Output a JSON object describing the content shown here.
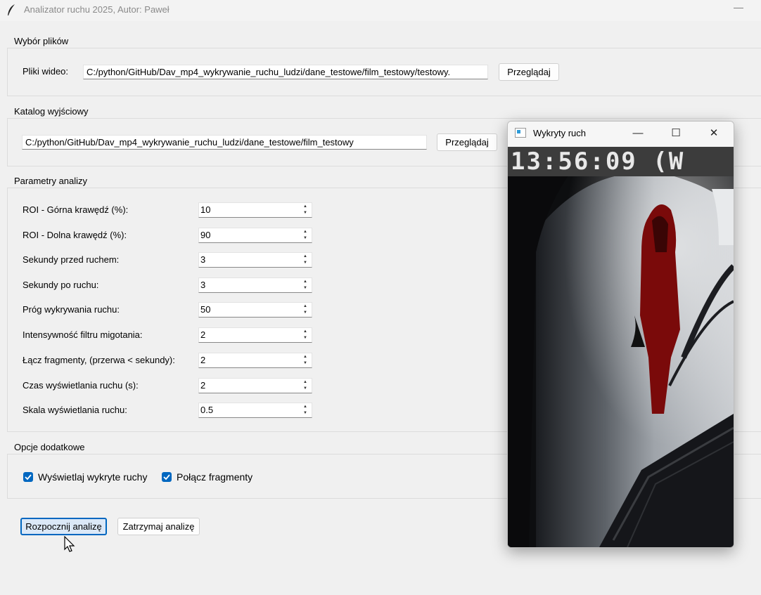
{
  "window": {
    "title": "Analizator ruchu 2025, Autor: Paweł",
    "minimize_glyph": "—"
  },
  "files": {
    "legend": "Wybór plików",
    "video_label": "Pliki wideo:",
    "video_path": "C:/python/GitHub/Dav_mp4_wykrywanie_ruchu_ludzi/dane_testowe/film_testowy/testowy.",
    "browse_label": "Przeglądaj"
  },
  "output": {
    "legend": "Katalog wyjściowy",
    "path": "C:/python/GitHub/Dav_mp4_wykrywanie_ruchu_ludzi/dane_testowe/film_testowy",
    "browse_label": "Przeglądaj"
  },
  "params": {
    "legend": "Parametry analizy",
    "rows": [
      {
        "label": "ROI - Górna krawędź (%):",
        "value": "10"
      },
      {
        "label": "ROI - Dolna krawędź (%):",
        "value": "90"
      },
      {
        "label": "Sekundy przed ruchem:",
        "value": "3"
      },
      {
        "label": "Sekundy po ruchu:",
        "value": "3"
      },
      {
        "label": "Próg wykrywania ruchu:",
        "value": "50"
      },
      {
        "label": "Intensywność filtru migotania:",
        "value": "2"
      },
      {
        "label": "Łącz fragmenty, (przerwa < sekundy):",
        "value": "2"
      },
      {
        "label": "Czas wyświetlania ruchu (s):",
        "value": "2"
      },
      {
        "label": "Skala wyświetlania ruchu:",
        "value": "0.5"
      }
    ]
  },
  "options": {
    "legend": "Opcje dodatkowe",
    "show_motion": {
      "label": "Wyświetlaj wykryte ruchy",
      "checked": true
    },
    "merge_fragments": {
      "label": "Połącz fragmenty",
      "checked": true
    }
  },
  "actions": {
    "start_label": "Rozpocznij analizę",
    "stop_label": "Zatrzymaj analizę"
  },
  "popup": {
    "title": "Wykryty ruch",
    "minimize_glyph": "—",
    "maximize_glyph": "☐",
    "close_glyph": "✕",
    "timestamp": "13:56:09 (W"
  },
  "colors": {
    "accent": "#0067c0",
    "title_text": "#8a8a8a"
  },
  "icons": {
    "app": "feather-icon",
    "popup": "window-icon",
    "pointer": "mouse-cursor-icon"
  }
}
